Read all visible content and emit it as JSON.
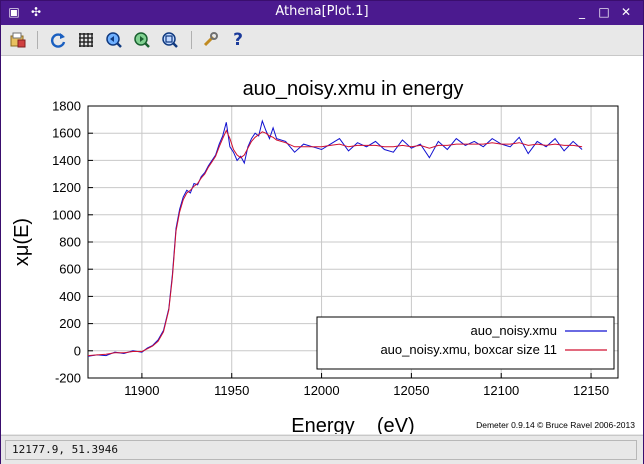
{
  "window": {
    "title": "Athena[Plot.1]",
    "menu_glyph": "▣",
    "pin_glyph": "✣",
    "minimize_glyph": "_",
    "maximize_glyph": "□",
    "close_glyph": "✕"
  },
  "toolbar": {
    "items": [
      {
        "name": "save-image-icon"
      },
      {
        "name": "refresh-icon"
      },
      {
        "name": "grid-icon"
      },
      {
        "name": "zoom-in-icon"
      },
      {
        "name": "zoom-out-icon"
      },
      {
        "name": "zoom-fit-icon"
      },
      {
        "name": "wrench-icon"
      },
      {
        "name": "help-icon",
        "label": "?"
      }
    ]
  },
  "chart_data": {
    "type": "line",
    "title": "auo_noisy.xmu in energy",
    "xlabel": "Energy    (eV)",
    "ylabel": "xμ(E)",
    "xlim": [
      11870,
      12165
    ],
    "ylim": [
      -200,
      1800
    ],
    "xticks": [
      11900,
      11950,
      12000,
      12050,
      12100,
      12150
    ],
    "yticks": [
      -200,
      0,
      200,
      400,
      600,
      800,
      1000,
      1200,
      1400,
      1600,
      1800
    ],
    "grid": true,
    "legend_position": "bottom-right",
    "series": [
      {
        "name": "auo_noisy.xmu",
        "color": "#1010d0",
        "x": [
          11870,
          11875,
          11880,
          11885,
          11890,
          11895,
          11900,
          11903,
          11906,
          11909,
          11912,
          11915,
          11917,
          11919,
          11921,
          11923,
          11925,
          11927,
          11929,
          11931,
          11933,
          11935,
          11937,
          11939,
          11941,
          11943,
          11945,
          11947,
          11949,
          11951,
          11953,
          11955,
          11957,
          11959,
          11961,
          11963,
          11965,
          11967,
          11969,
          11971,
          11973,
          11975,
          11980,
          11985,
          11990,
          11995,
          12000,
          12005,
          12010,
          12015,
          12020,
          12025,
          12030,
          12035,
          12040,
          12045,
          12050,
          12055,
          12060,
          12065,
          12070,
          12075,
          12080,
          12085,
          12090,
          12095,
          12100,
          12105,
          12110,
          12115,
          12120,
          12125,
          12130,
          12135,
          12140,
          12145
        ],
        "y": [
          -40,
          -30,
          -35,
          -10,
          -20,
          0,
          -10,
          20,
          40,
          80,
          150,
          310,
          560,
          900,
          1040,
          1130,
          1180,
          1160,
          1230,
          1220,
          1280,
          1310,
          1360,
          1400,
          1440,
          1520,
          1580,
          1680,
          1500,
          1460,
          1400,
          1430,
          1380,
          1500,
          1560,
          1600,
          1580,
          1690,
          1620,
          1560,
          1640,
          1560,
          1540,
          1460,
          1520,
          1500,
          1480,
          1520,
          1560,
          1470,
          1530,
          1500,
          1540,
          1480,
          1460,
          1550,
          1490,
          1520,
          1420,
          1540,
          1480,
          1560,
          1510,
          1540,
          1500,
          1560,
          1520,
          1500,
          1570,
          1450,
          1540,
          1500,
          1560,
          1470,
          1540,
          1480
        ]
      },
      {
        "name": "auo_noisy.xmu, boxcar size 11",
        "color": "#d01030",
        "x": [
          11870,
          11875,
          11880,
          11885,
          11890,
          11895,
          11900,
          11903,
          11906,
          11909,
          11912,
          11915,
          11917,
          11919,
          11921,
          11923,
          11925,
          11927,
          11929,
          11931,
          11933,
          11935,
          11937,
          11939,
          11941,
          11943,
          11945,
          11947,
          11949,
          11951,
          11953,
          11955,
          11957,
          11959,
          11961,
          11963,
          11965,
          11967,
          11969,
          11971,
          11973,
          11975,
          11980,
          11985,
          11990,
          11995,
          12000,
          12005,
          12010,
          12015,
          12020,
          12025,
          12030,
          12035,
          12040,
          12045,
          12050,
          12055,
          12060,
          12065,
          12070,
          12075,
          12080,
          12085,
          12090,
          12095,
          12100,
          12105,
          12110,
          12115,
          12120,
          12125,
          12130,
          12135,
          12140,
          12145
        ],
        "y": [
          -35,
          -30,
          -25,
          -15,
          -15,
          -5,
          -5,
          15,
          35,
          70,
          140,
          300,
          540,
          880,
          1020,
          1110,
          1160,
          1180,
          1210,
          1230,
          1270,
          1300,
          1350,
          1390,
          1430,
          1500,
          1560,
          1620,
          1560,
          1480,
          1440,
          1420,
          1440,
          1490,
          1540,
          1570,
          1590,
          1610,
          1600,
          1580,
          1570,
          1550,
          1530,
          1500,
          1500,
          1500,
          1500,
          1510,
          1520,
          1500,
          1510,
          1510,
          1510,
          1500,
          1500,
          1510,
          1500,
          1510,
          1490,
          1510,
          1510,
          1520,
          1520,
          1520,
          1520,
          1530,
          1520,
          1520,
          1530,
          1510,
          1520,
          1510,
          1520,
          1510,
          1510,
          1500
        ]
      }
    ]
  },
  "credit": "Demeter 0.9.14 © Bruce Ravel 2006-2013",
  "status": {
    "coords": "12177.9, 51.3946"
  }
}
